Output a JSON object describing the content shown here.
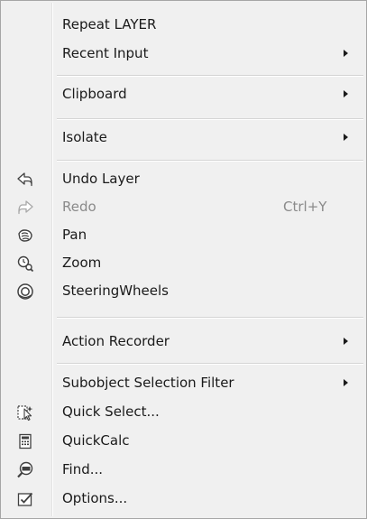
{
  "menu": {
    "items": [
      {
        "label": "Repeat LAYER"
      },
      {
        "label": "Recent Input"
      },
      {
        "label": "Clipboard"
      },
      {
        "label": "Isolate"
      },
      {
        "label": "Undo Layer",
        "icon": "undo-arrow-icon"
      },
      {
        "label": "Redo",
        "icon": "redo-arrow-icon",
        "shortcut": "Ctrl+Y",
        "disabled": true
      },
      {
        "label": "Pan",
        "icon": "pan-hand-icon"
      },
      {
        "label": "Zoom",
        "icon": "zoom-icon"
      },
      {
        "label": "SteeringWheels",
        "icon": "steering-wheels-icon"
      },
      {
        "label": "Action Recorder"
      },
      {
        "label": "Subobject Selection Filter"
      },
      {
        "label": "Quick Select...",
        "icon": "quick-select-icon"
      },
      {
        "label": "QuickCalc",
        "icon": "calculator-icon"
      },
      {
        "label": "Find...",
        "icon": "find-icon"
      },
      {
        "label": "Options...",
        "icon": "options-checkbox-icon"
      }
    ]
  },
  "colors": {
    "background": "#f0f0f0",
    "text": "#1a1a1a",
    "disabled_text": "#8a8a8a",
    "icon_stroke": "#404040",
    "separator": "#d4d4d4",
    "border": "#a6a6a6"
  }
}
